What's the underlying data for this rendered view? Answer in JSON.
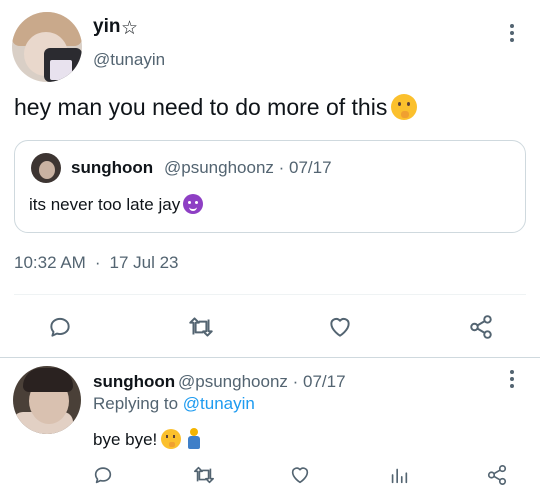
{
  "main_tweet": {
    "author_name": "yin",
    "author_badge": "☆",
    "author_handle": "@tunayin",
    "text": "hey man you need to do more of this",
    "emoji": "shushing-face",
    "quote": {
      "author_name": "sunghoon",
      "author_meta": "@psunghoonz · 07/17",
      "text": "its never too late jay",
      "emoji": "smiling-devil"
    },
    "time": "10:32 AM",
    "date": "17 Jul 23",
    "actions": [
      "reply-icon",
      "retweet-icon",
      "like-icon",
      "share-icon"
    ]
  },
  "reply_tweet": {
    "author_name": "sunghoon",
    "author_meta": "@psunghoonz · 07/17",
    "replying_prefix": "Replying to",
    "replying_handle": "@tunayin",
    "text": "bye bye!",
    "emojis": [
      "shushing-face",
      "dancer"
    ],
    "actions": [
      "reply-icon",
      "retweet-icon",
      "like-icon",
      "analytics-icon",
      "share-icon"
    ]
  },
  "colors": {
    "text": "#0f1419",
    "secondary": "#536471",
    "link": "#1d9bf0",
    "border": "#cfd9de"
  }
}
